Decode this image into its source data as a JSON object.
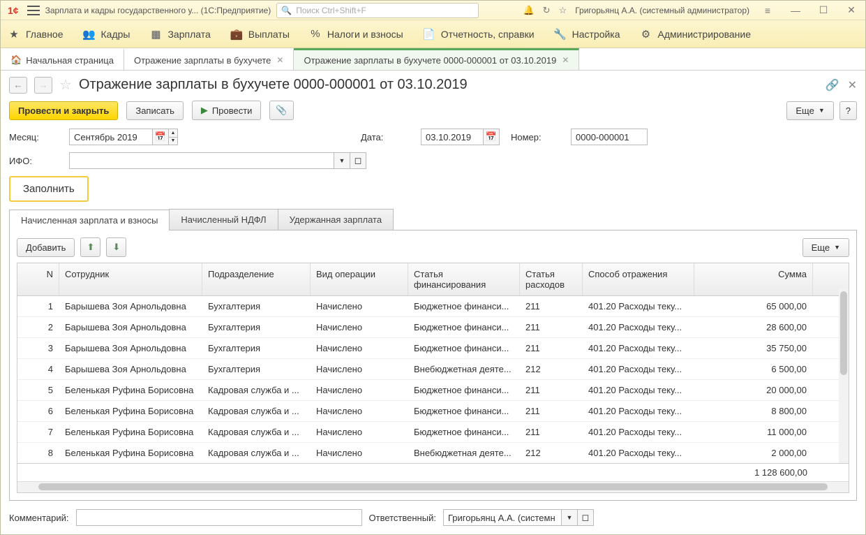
{
  "title_bar": {
    "app_title": "Зарплата и кадры государственного у...  (1С:Предприятие)",
    "search_placeholder": "Поиск Ctrl+Shift+F",
    "user": "Григорьянц А.А. (системный администратор)"
  },
  "nav": {
    "main": "Главное",
    "kadry": "Кадры",
    "zarplata": "Зарплата",
    "vyplaty": "Выплаты",
    "nalogi": "Налоги и взносы",
    "otchet": "Отчетность, справки",
    "nastroyka": "Настройка",
    "admin": "Администрирование"
  },
  "tabs": {
    "home": "Начальная страница",
    "t1": "Отражение зарплаты в бухучете",
    "t2": "Отражение зарплаты в бухучете 0000-000001 от 03.10.2019"
  },
  "doc": {
    "title": "Отражение зарплаты в бухучете 0000-000001 от 03.10.2019",
    "btn_primary": "Провести и закрыть",
    "btn_save": "Записать",
    "btn_post": "Провести",
    "btn_more": "Еще",
    "btn_help": "?"
  },
  "form": {
    "month_label": "Месяц:",
    "month_value": "Сентябрь 2019",
    "date_label": "Дата:",
    "date_value": "03.10.2019",
    "num_label": "Номер:",
    "num_value": "0000-000001",
    "ifo_label": "ИФО:",
    "ifo_value": "",
    "fill_btn": "Заполнить"
  },
  "subtabs": {
    "t1": "Начисленная зарплата и взносы",
    "t2": "Начисленный НДФЛ",
    "t3": "Удержанная зарплата"
  },
  "pane": {
    "add": "Добавить",
    "more": "Еще"
  },
  "cols": {
    "n": "N",
    "emp": "Сотрудник",
    "dep": "Подразделение",
    "op": "Вид операции",
    "fin": "Статья финансирования",
    "exp": "Статья расходов",
    "ref": "Способ отражения",
    "sum": "Сумма"
  },
  "rows": [
    {
      "n": "1",
      "emp": "Барышева Зоя Арнольдовна",
      "dep": "Бухгалтерия",
      "op": "Начислено",
      "fin": "Бюджетное финанси...",
      "exp": "211",
      "ref": "401.20 Расходы теку...",
      "sum": "65 000,00"
    },
    {
      "n": "2",
      "emp": "Барышева Зоя Арнольдовна",
      "dep": "Бухгалтерия",
      "op": "Начислено",
      "fin": "Бюджетное финанси...",
      "exp": "211",
      "ref": "401.20 Расходы теку...",
      "sum": "28 600,00"
    },
    {
      "n": "3",
      "emp": "Барышева Зоя Арнольдовна",
      "dep": "Бухгалтерия",
      "op": "Начислено",
      "fin": "Бюджетное финанси...",
      "exp": "211",
      "ref": "401.20 Расходы теку...",
      "sum": "35 750,00"
    },
    {
      "n": "4",
      "emp": "Барышева Зоя Арнольдовна",
      "dep": "Бухгалтерия",
      "op": "Начислено",
      "fin": "Внебюджетная деяте...",
      "exp": "212",
      "ref": "401.20 Расходы теку...",
      "sum": "6 500,00"
    },
    {
      "n": "5",
      "emp": "Беленькая Руфина Борисовна",
      "dep": "Кадровая служба и ...",
      "op": "Начислено",
      "fin": "Бюджетное финанси...",
      "exp": "211",
      "ref": "401.20 Расходы теку...",
      "sum": "20 000,00"
    },
    {
      "n": "6",
      "emp": "Беленькая Руфина Борисовна",
      "dep": "Кадровая служба и ...",
      "op": "Начислено",
      "fin": "Бюджетное финанси...",
      "exp": "211",
      "ref": "401.20 Расходы теку...",
      "sum": "8 800,00"
    },
    {
      "n": "7",
      "emp": "Беленькая Руфина Борисовна",
      "dep": "Кадровая служба и ...",
      "op": "Начислено",
      "fin": "Бюджетное финанси...",
      "exp": "211",
      "ref": "401.20 Расходы теку...",
      "sum": "11 000,00"
    },
    {
      "n": "8",
      "emp": "Беленькая Руфина Борисовна",
      "dep": "Кадровая служба и ...",
      "op": "Начислено",
      "fin": "Внебюджетная деяте...",
      "exp": "212",
      "ref": "401.20 Расходы теку...",
      "sum": "2 000,00"
    }
  ],
  "total": "1 128 600,00",
  "footer": {
    "comment_label": "Комментарий:",
    "comment_value": "",
    "resp_label": "Ответственный:",
    "resp_value": "Григорьянц А.А. (системн"
  }
}
